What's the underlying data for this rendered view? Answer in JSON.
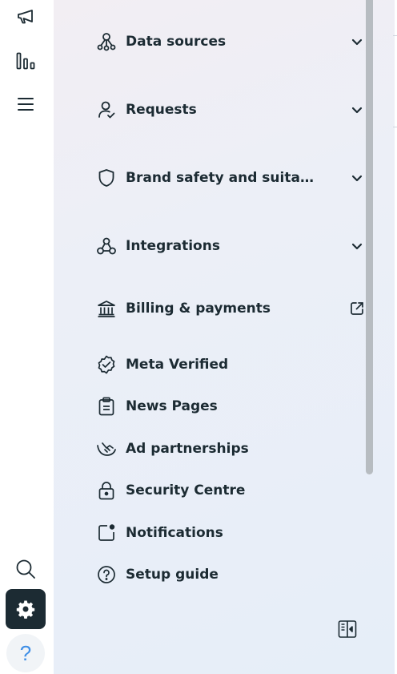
{
  "rail": {
    "items": [
      {
        "name": "megaphone-icon"
      },
      {
        "name": "bar-chart-icon"
      },
      {
        "name": "menu-icon"
      },
      {
        "name": "search-icon"
      },
      {
        "name": "gear-icon",
        "active": true
      },
      {
        "name": "help-icon",
        "glyph": "?"
      }
    ]
  },
  "menu": {
    "items": [
      {
        "label": "Data sources",
        "icon": "data-sources-icon",
        "trailing": "chevron-down-icon"
      },
      {
        "label": "Requests",
        "icon": "requests-icon",
        "trailing": "chevron-down-icon"
      },
      {
        "label": "Brand safety and suitabi…",
        "icon": "shield-icon",
        "trailing": "chevron-down-icon"
      },
      {
        "label": "Integrations",
        "icon": "integrations-icon",
        "trailing": "chevron-down-icon"
      },
      {
        "label": "Billing & payments",
        "icon": "bank-icon",
        "trailing": "external-link-icon"
      },
      {
        "label": "Meta Verified",
        "icon": "verified-badge-icon"
      },
      {
        "label": "News Pages",
        "icon": "clipboard-icon"
      },
      {
        "label": "Ad partnerships",
        "icon": "handshake-icon"
      },
      {
        "label": "Security Centre",
        "icon": "lock-icon"
      },
      {
        "label": "Notifications",
        "icon": "notification-icon"
      },
      {
        "label": "Setup guide",
        "icon": "question-circle-icon"
      }
    ]
  },
  "footer": {
    "collapse_icon": "collapse-panel-icon"
  },
  "colors": {
    "text": "#1c2b33",
    "active_bg": "#1c2b33",
    "help_accent": "#3f8fe6",
    "scrollbar": "#b7bcc1"
  }
}
